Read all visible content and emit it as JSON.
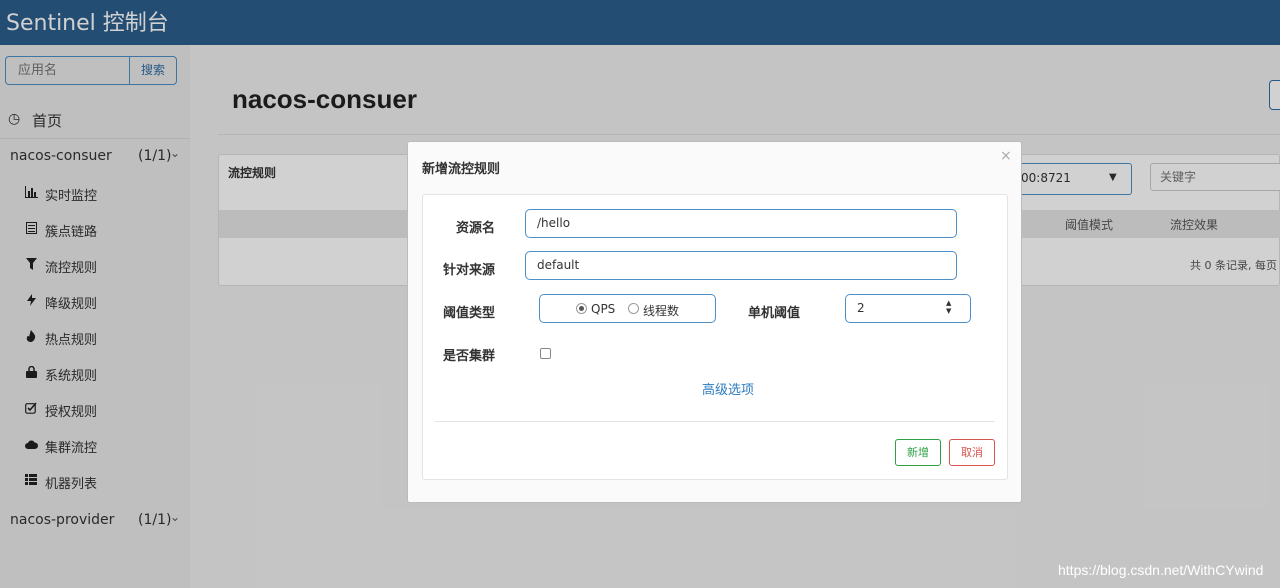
{
  "header": {
    "title": "Sentinel 控制台"
  },
  "sidebar": {
    "search_placeholder": "应用名",
    "search_button": "搜索",
    "home_label": "首页",
    "apps": [
      {
        "name": "nacos-consuer",
        "count": "(1/1)"
      },
      {
        "name": "nacos-provider",
        "count": "(1/1)"
      }
    ],
    "menu": [
      {
        "label": "实时监控",
        "icon": "bar-chart-icon"
      },
      {
        "label": "簇点链路",
        "icon": "list-icon"
      },
      {
        "label": "流控规则",
        "icon": "filter-icon"
      },
      {
        "label": "降级规则",
        "icon": "flash-icon"
      },
      {
        "label": "热点规则",
        "icon": "fire-icon"
      },
      {
        "label": "系统规则",
        "icon": "lock-icon"
      },
      {
        "label": "授权规则",
        "icon": "check-square-icon"
      },
      {
        "label": "集群流控",
        "icon": "cloud-icon"
      },
      {
        "label": "机器列表",
        "icon": "th-list-icon"
      }
    ]
  },
  "main": {
    "title": "nacos-consuer",
    "panel_title": "流控规则",
    "machine_select": "00:8721",
    "keyword_placeholder": "关键字",
    "columns": [
      "阈值模式",
      "流控效果"
    ],
    "pager": "共 0 条记录, 每页"
  },
  "modal": {
    "title": "新增流控规则",
    "close": "×",
    "fields": {
      "resource_label": "资源名",
      "resource_value": "/hello",
      "origin_label": "针对来源",
      "origin_value": "default",
      "threshold_type_label": "阈值类型",
      "threshold_type_options": [
        "QPS",
        "线程数"
      ],
      "threshold_type_selected": "QPS",
      "single_threshold_label": "单机阈值",
      "single_threshold_value": "2",
      "cluster_label": "是否集群"
    },
    "advanced_link": "高级选项",
    "add_button": "新增",
    "cancel_button": "取消"
  },
  "watermark": "https://blog.csdn.net/WithCYwind",
  "colors": {
    "header": "#2b5f8c",
    "accent": "#4d8fc7",
    "add": "#2ea043",
    "cancel": "#d9534f"
  }
}
